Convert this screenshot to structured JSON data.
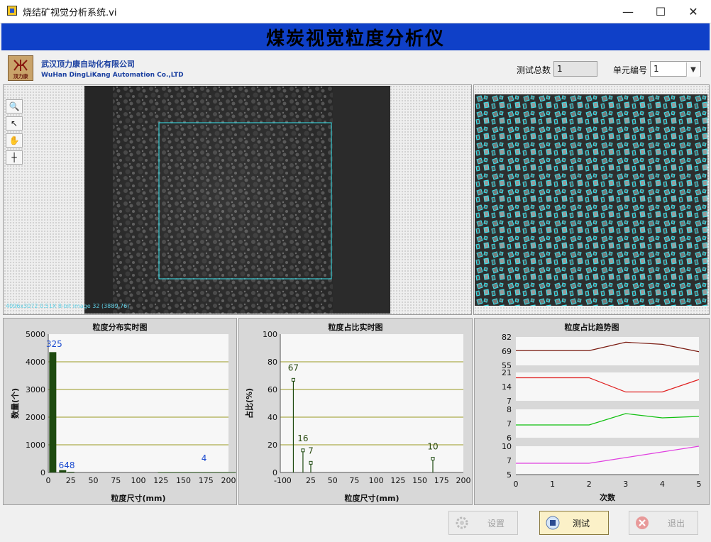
{
  "window": {
    "title": "烧结矿视觉分析系统.vi",
    "controls": [
      "—",
      "☐",
      "✕"
    ]
  },
  "banner": {
    "title": "煤炭视觉粒度分析仪"
  },
  "company": {
    "name_cn": "武汉顶力康自动化有限公司",
    "name_en": "WuHan DingLiKang Automation Co.,LTD",
    "logo_text": "顶力康"
  },
  "header": {
    "test_count_label": "测试总数",
    "test_count_value": "1",
    "unit_label": "单元编号",
    "unit_value": "1"
  },
  "viewer": {
    "tools": [
      "zoom-icon",
      "pointer-icon",
      "pan-icon",
      "crosshair-icon"
    ],
    "status_text": "4096x3072 0.51X 8-bit image 32     (3889,76)"
  },
  "charts": {
    "distribution": {
      "title": "粒度分布实时图",
      "xlabel": "粒度尺寸(mm)",
      "ylabel": "数量(个)",
      "yticks": [
        "5000",
        "4000",
        "3000",
        "2000",
        "1000",
        "0"
      ],
      "xticks": [
        "0",
        "25",
        "50",
        "75",
        "100",
        "125",
        "150",
        "175",
        "200"
      ]
    },
    "ratio": {
      "title": "粒度占比实时图",
      "xlabel": "粒度尺寸(mm)",
      "ylabel": "占比(%)",
      "yticks": [
        "100",
        "80",
        "60",
        "40",
        "20",
        "0"
      ],
      "xticks": [
        "-10",
        "0",
        "25",
        "50",
        "75",
        "100",
        "125",
        "150",
        "175",
        "200"
      ]
    },
    "trend": {
      "title": "粒度占比趋势图",
      "xlabel": "次数",
      "xticks": [
        "0",
        "1",
        "2",
        "3",
        "4",
        "5"
      ],
      "panels": [
        {
          "yticks": [
            "82",
            "69",
            "55"
          ]
        },
        {
          "yticks": [
            "21",
            "14",
            "7"
          ]
        },
        {
          "yticks": [
            "8",
            "7",
            "6"
          ]
        },
        {
          "yticks": [
            "10",
            "7",
            "5"
          ]
        }
      ]
    }
  },
  "chart_data": [
    {
      "type": "bar",
      "title": "粒度分布实时图",
      "xlabel": "粒度尺寸(mm)",
      "ylabel": "数量(个)",
      "xlim": [
        0,
        200
      ],
      "ylim": [
        0,
        5000
      ],
      "x": [
        5,
        16,
        25,
        165
      ],
      "values": [
        4350,
        85,
        25,
        10
      ],
      "data_labels": [
        "325",
        "64",
        "8",
        "4"
      ],
      "colors": {
        "bar": "#1e4a10",
        "grid": "#9a9a20"
      }
    },
    {
      "type": "bar",
      "title": "粒度占比实时图",
      "xlabel": "粒度尺寸(mm)",
      "ylabel": "占比(%)",
      "xlim": [
        -10,
        200
      ],
      "ylim": [
        0,
        100
      ],
      "x": [
        5,
        16,
        25,
        165
      ],
      "values": [
        67,
        16,
        7,
        10
      ],
      "data_labels": [
        "67",
        "16",
        "7",
        "10"
      ],
      "colors": {
        "stem": "#1e4a10"
      }
    },
    {
      "type": "line",
      "title": "粒度占比趋势图",
      "xlabel": "次数",
      "x": [
        0,
        1,
        2,
        3,
        4,
        5
      ],
      "series": [
        {
          "values": [
            69,
            69,
            69,
            77,
            75,
            68
          ],
          "ylim": [
            55,
            82
          ],
          "color": "#7a1a10"
        },
        {
          "values": [
            18,
            18,
            18,
            10,
            10,
            17
          ],
          "ylim": [
            5,
            21
          ],
          "color": "#e02020"
        },
        {
          "values": [
            6.9,
            6.9,
            6.9,
            7.7,
            7.4,
            7.5
          ],
          "ylim": [
            6,
            8
          ],
          "color": "#10c010"
        },
        {
          "values": [
            7,
            7,
            7,
            8,
            9,
            10
          ],
          "ylim": [
            5,
            10
          ],
          "color": "#e040e0"
        }
      ]
    }
  ],
  "buttons": {
    "settings": "设置",
    "test": "测试",
    "exit": "退出"
  },
  "colors": {
    "banner": "#0f40c8",
    "overlay": "#39e6f0"
  }
}
